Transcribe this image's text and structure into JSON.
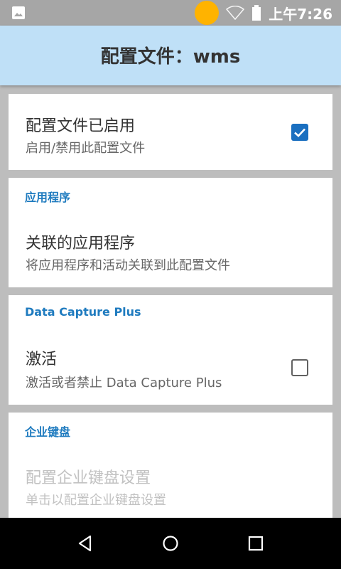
{
  "status_bar": {
    "time": "上午7:26",
    "icons": [
      "image-notification-icon",
      "notification-dot-icon",
      "wifi-icon",
      "battery-icon"
    ],
    "accent_color": "#ffb300"
  },
  "app_bar": {
    "title": "配置文件：wms",
    "background": "#bfe0f7"
  },
  "sections": [
    {
      "items": [
        {
          "title": "配置文件已启用",
          "summary": "启用/禁用此配置文件",
          "checkbox": true
        }
      ]
    },
    {
      "category": "应用程序",
      "items": [
        {
          "title": "关联的应用程序",
          "summary": "将应用程序和活动关联到此配置文件"
        }
      ]
    },
    {
      "category": "Data Capture Plus",
      "items": [
        {
          "title": "激活",
          "summary": "激活或者禁止 Data Capture Plus",
          "checkbox": false
        }
      ]
    },
    {
      "category": "企业键盘",
      "items": [
        {
          "title": "配置企业键盘设置",
          "summary": "单击以配置企业键盘设置",
          "enabled": false
        }
      ]
    }
  ],
  "nav_bar": {
    "buttons": [
      "back-icon",
      "home-icon",
      "recents-icon"
    ]
  }
}
